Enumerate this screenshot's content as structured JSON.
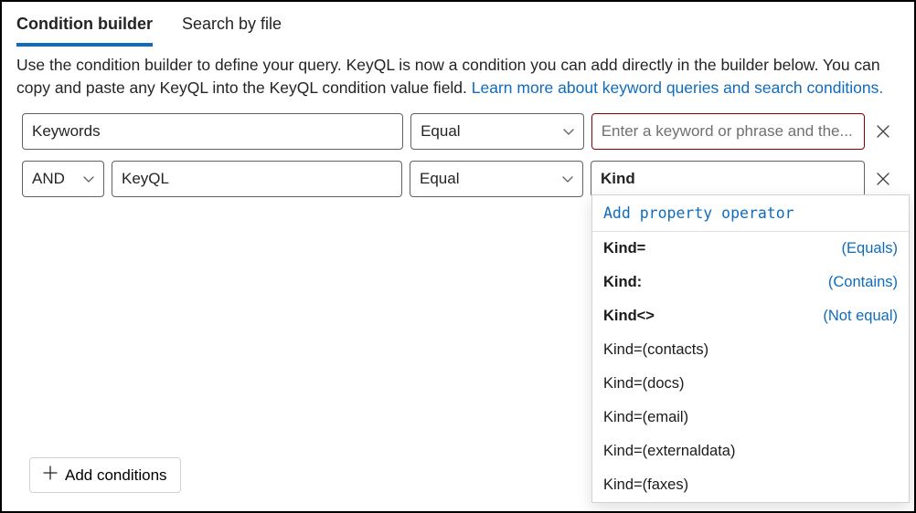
{
  "tabs": {
    "condition_builder": "Condition builder",
    "search_by_file": "Search by file"
  },
  "description": {
    "text": "Use the condition builder to define your query. KeyQL is now a condition you can add directly in the builder below. You can copy and paste any KeyQL into the KeyQL condition value field.",
    "link": "Learn more about keyword queries and search conditions."
  },
  "row1": {
    "field": "Keywords",
    "operator": "Equal",
    "value_placeholder": "Enter a keyword or phrase and the..."
  },
  "row2": {
    "logic": "AND",
    "field": "KeyQL",
    "operator": "Equal",
    "value": "Kind"
  },
  "add_button": "Add conditions",
  "suggestions": {
    "header": "Add property operator",
    "operators": [
      {
        "label": "Kind=",
        "hint": "(Equals)"
      },
      {
        "label": "Kind:",
        "hint": "(Contains)"
      },
      {
        "label": "Kind<>",
        "hint": "(Not equal)"
      }
    ],
    "values": [
      "Kind=(contacts)",
      "Kind=(docs)",
      "Kind=(email)",
      "Kind=(externaldata)",
      "Kind=(faxes)"
    ]
  }
}
